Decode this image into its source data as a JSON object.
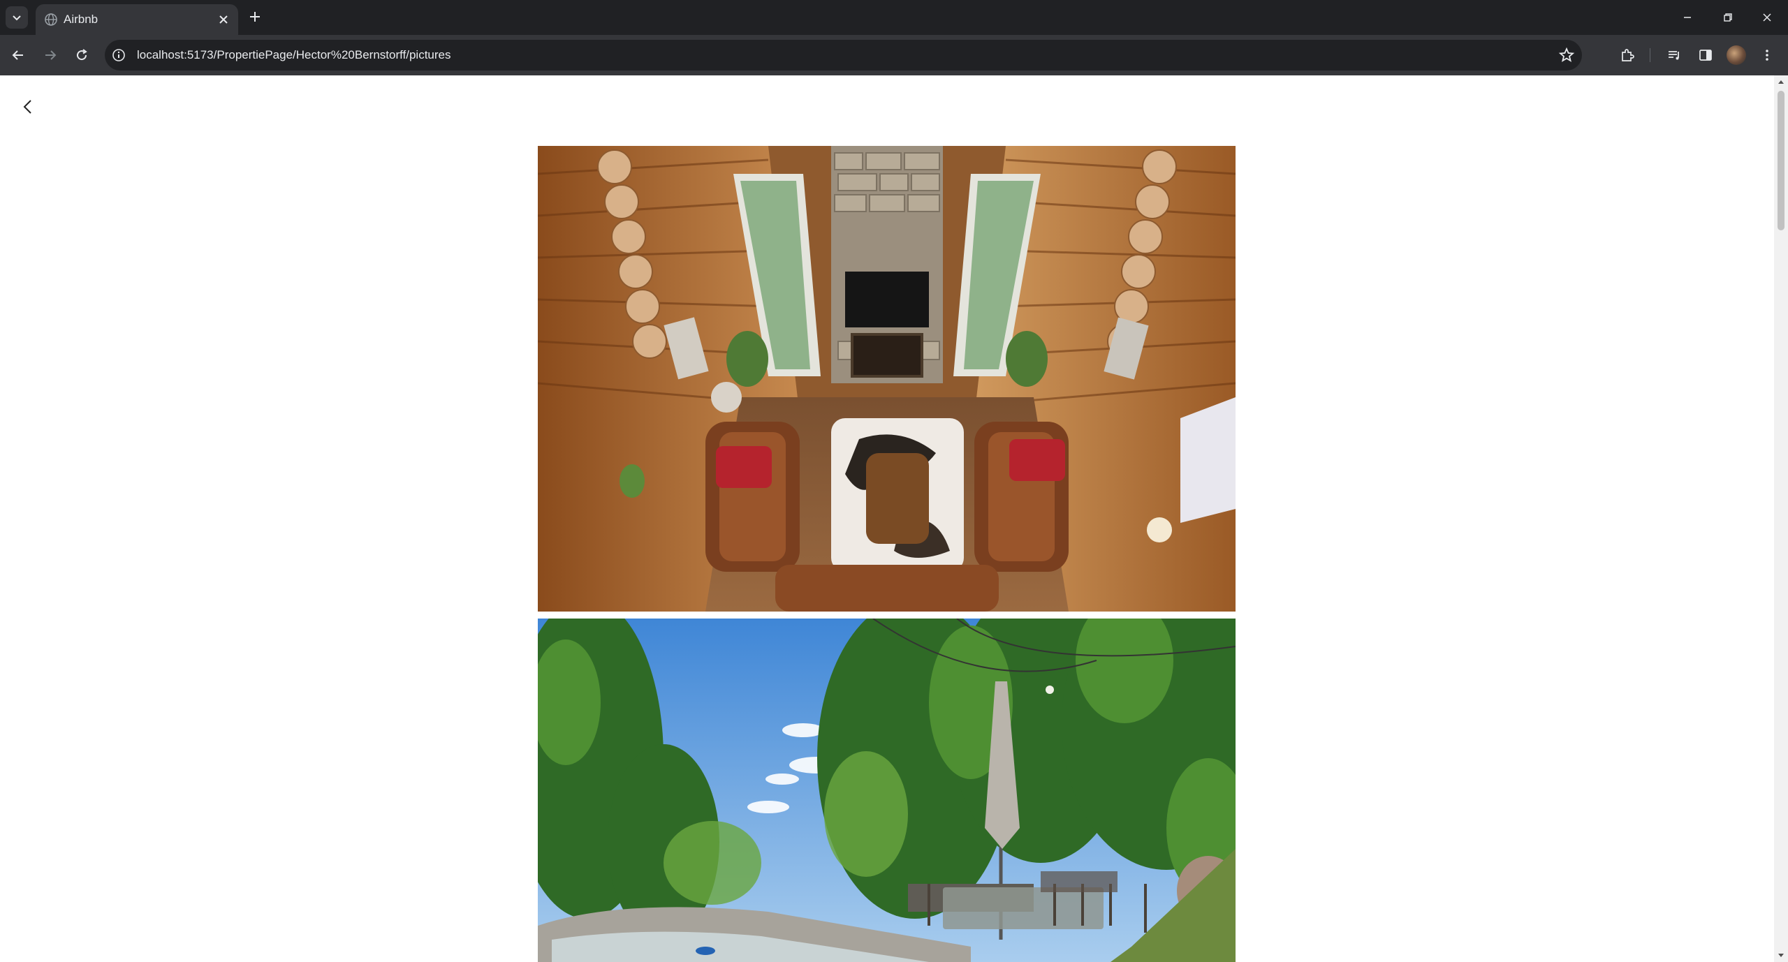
{
  "browser": {
    "tab_title": "Airbnb",
    "url": "localhost:5173/PropertiePage/Hector%20Bernstorff/pictures"
  },
  "page": {
    "photos": [
      {
        "name": "living-room-overhead-photo"
      },
      {
        "name": "patio-hot-tub-photo"
      }
    ]
  },
  "colors": {
    "chrome_dark": "#202124",
    "chrome_mid": "#35363a",
    "chrome_text": "#e8eaed",
    "page_bg": "#ffffff"
  }
}
